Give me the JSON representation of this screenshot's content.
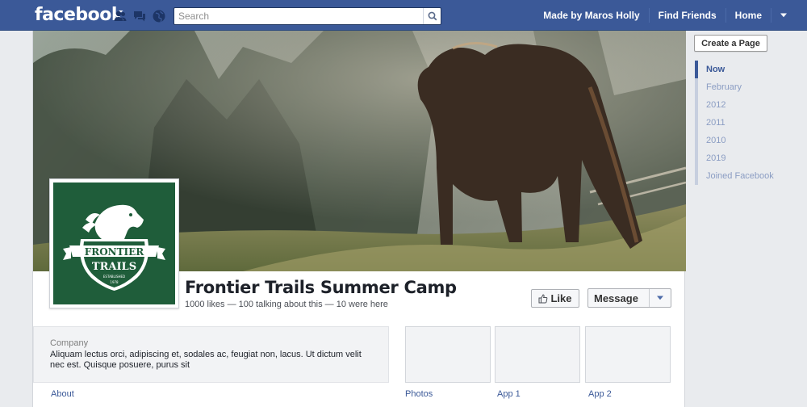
{
  "header": {
    "logo": "facebook",
    "search_placeholder": "Search",
    "nav_links": [
      "Made by Maros Holly",
      "Find Friends",
      "Home"
    ]
  },
  "colors": {
    "brand_blue": "#3b5998",
    "profile_green": "#1f5d3a",
    "rail_inactive": "#8b9dc3"
  },
  "icons": {
    "jewels": [
      "friends-icon",
      "messages-icon",
      "notifications-globe-icon"
    ],
    "search": "search-icon",
    "account_menu": "chevron-down-icon"
  },
  "page": {
    "name": "Frontier Trails Summer Camp",
    "stats": "1000 likes — 100 talking about this — 10 were here",
    "like_label": "Like",
    "message_label": "Message",
    "logo_text": {
      "line1": "FRONTIER",
      "line2": "TRAILS",
      "established": "ESTABLISHED",
      "year": "1978"
    }
  },
  "about": {
    "category": "Company",
    "text": "Aliquam lectus orci, adipiscing et, sodales ac, feugiat non, lacus. Ut dictum velit nec est. Quisque posuere, purus sit"
  },
  "tabs": [
    "About",
    "Photos",
    "App 1",
    "App 2"
  ],
  "rail": {
    "create_page": "Create a Page",
    "timeline": [
      "Now",
      "February",
      "2012",
      "2011",
      "2010",
      "2019",
      "Joined Facebook"
    ]
  }
}
